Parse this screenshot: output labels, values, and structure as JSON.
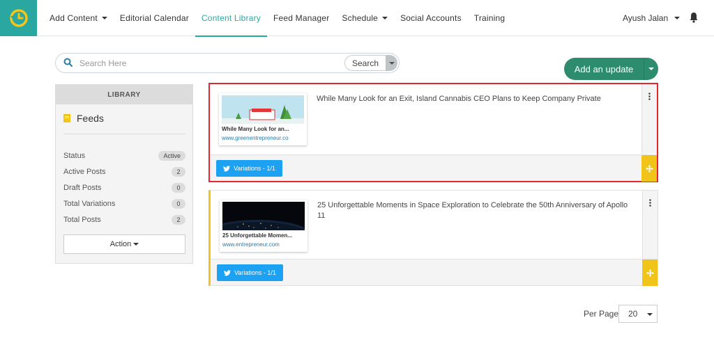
{
  "nav": {
    "items": [
      {
        "label": "Add Content",
        "dropdown": true,
        "active": false
      },
      {
        "label": "Editorial Calendar",
        "dropdown": false,
        "active": false
      },
      {
        "label": "Content Library",
        "dropdown": false,
        "active": true
      },
      {
        "label": "Feed Manager",
        "dropdown": false,
        "active": false
      },
      {
        "label": "Schedule",
        "dropdown": true,
        "active": false
      },
      {
        "label": "Social Accounts",
        "dropdown": false,
        "active": false
      },
      {
        "label": "Training",
        "dropdown": false,
        "active": false
      }
    ],
    "user_name": "Ayush Jalan"
  },
  "search": {
    "placeholder": "Search Here",
    "button_label": "Search"
  },
  "add_update": {
    "label": "Add an update"
  },
  "sidebar": {
    "header": "LIBRARY",
    "title": "Feeds",
    "stats": [
      {
        "label": "Status",
        "value": "Active"
      },
      {
        "label": "Active Posts",
        "value": "2"
      },
      {
        "label": "Draft Posts",
        "value": "0"
      },
      {
        "label": "Total Variations",
        "value": "0"
      },
      {
        "label": "Total Posts",
        "value": "2"
      }
    ],
    "action_label": "Action"
  },
  "posts": [
    {
      "text": "While Many Look for an Exit, Island Cannabis CEO Plans to Keep Company Private",
      "thumb_title": "While Many Look for an...",
      "thumb_url": "www.greenentrepreneur.co",
      "variations_label": "Variations - 1/1"
    },
    {
      "text": "25 Unforgettable Moments in Space Exploration to Celebrate the 50th Anniversary of Apollo 11",
      "thumb_title": "25 Unforgettable Momen...",
      "thumb_url": "www.entrepreneur.com",
      "variations_label": "Variations - 1/1"
    }
  ],
  "pagination": {
    "per_page_label": "Per Page",
    "per_page_value": "20"
  },
  "colors": {
    "brand": "#2aa7a1",
    "add_button": "#2d8c6d",
    "highlight_border": "#e3262f",
    "accent_yellow": "#f0c419",
    "twitter_blue": "#1da1f2"
  }
}
